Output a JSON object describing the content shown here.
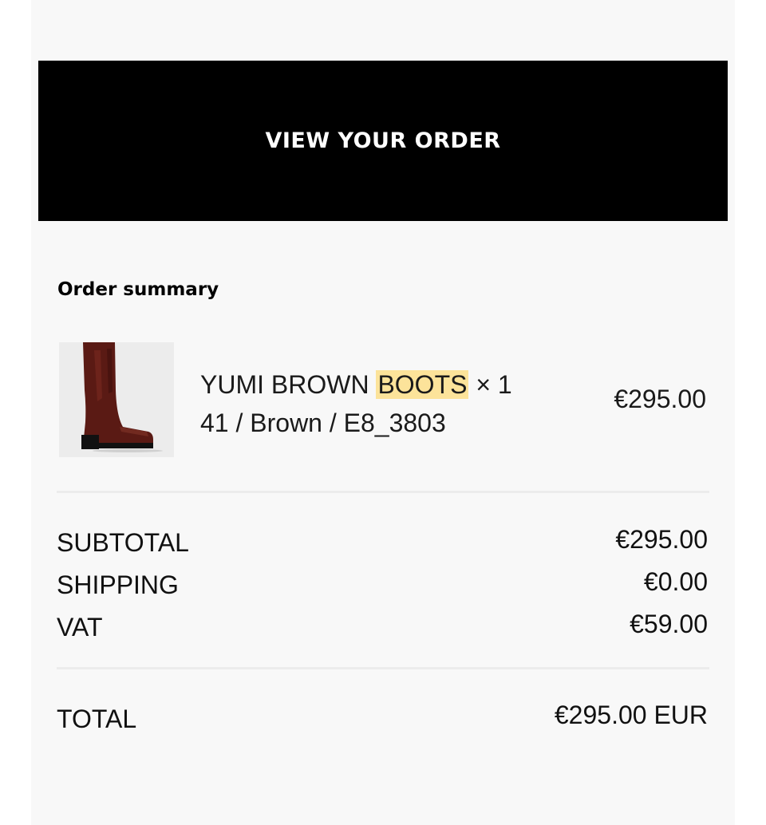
{
  "cta": {
    "label": "VIEW YOUR ORDER"
  },
  "summary": {
    "heading": "Order summary",
    "item": {
      "name_prefix": "YUMI BROWN",
      "name_highlight": "BOOTS",
      "quantity": "× 1",
      "variant": "41 / Brown / E8_3803",
      "price": "€295.00",
      "image_icon": "brown-boot-image"
    },
    "subtotal": {
      "label": "SUBTOTAL",
      "value": "€295.00"
    },
    "shipping": {
      "label": "SHIPPING",
      "value": "€0.00"
    },
    "vat": {
      "label": "VAT",
      "value": "€59.00"
    },
    "total": {
      "label": "TOTAL",
      "value": "€295.00 EUR"
    }
  },
  "colors": {
    "button_bg": "#000000",
    "button_text": "#ffffff",
    "highlight": "#fce39a",
    "sheet_bg": "#f8f8f8"
  }
}
